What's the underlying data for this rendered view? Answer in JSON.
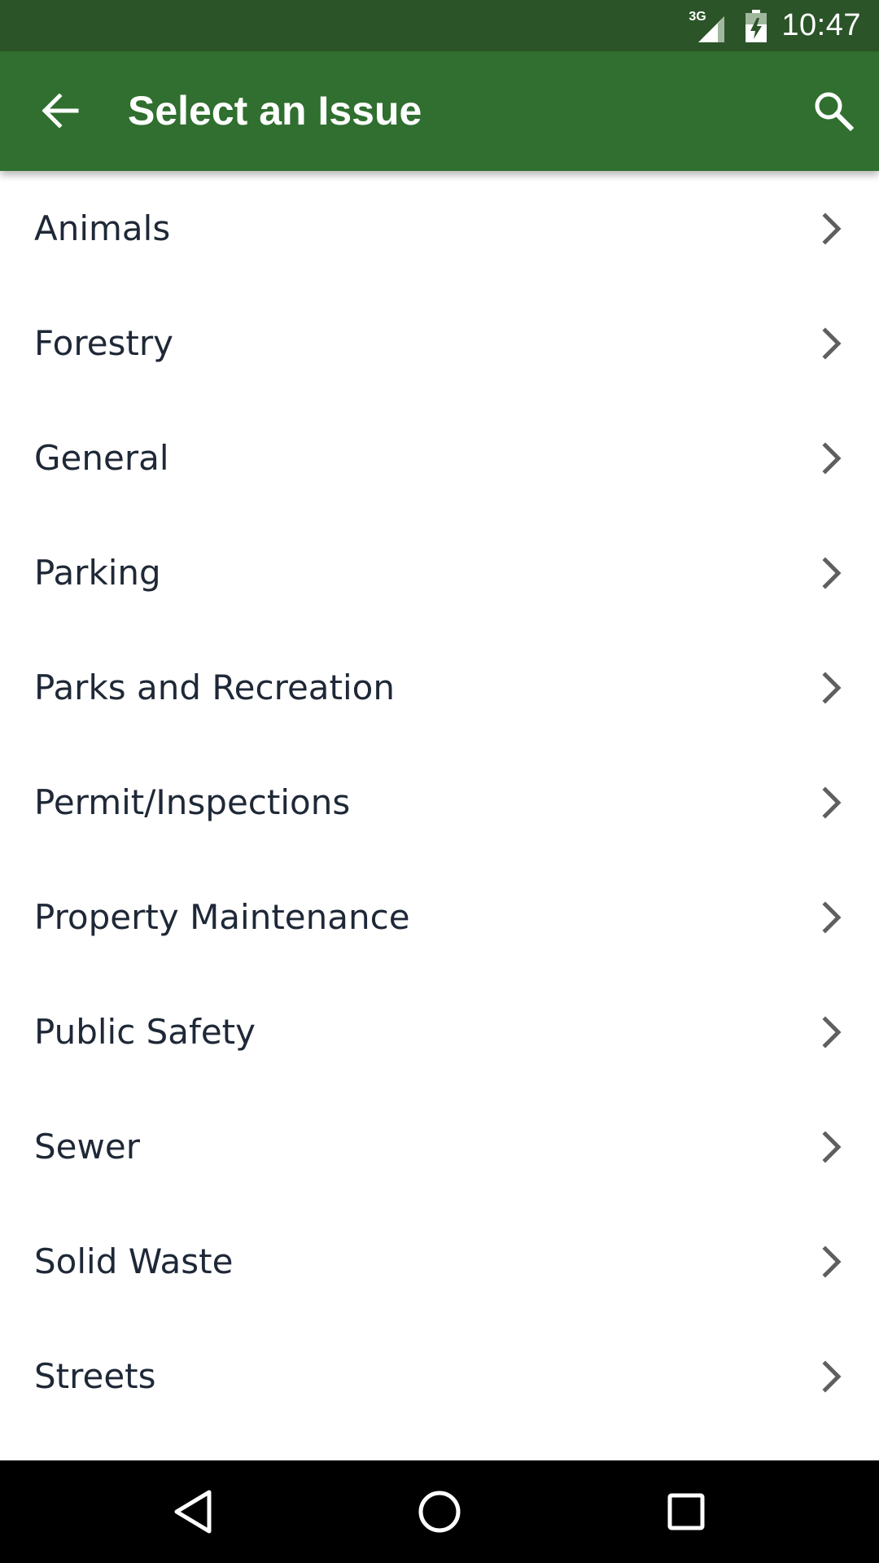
{
  "status_bar": {
    "network_label": "3G",
    "time": "10:47",
    "icons": [
      "signal-icon",
      "battery-charging-icon"
    ]
  },
  "app_bar": {
    "title": "Select an Issue",
    "back_icon": "arrow-left-icon",
    "search_icon": "search-icon",
    "color": "#306f2f",
    "status_color": "#2b5428"
  },
  "issues": [
    {
      "label": "Animals"
    },
    {
      "label": "Forestry"
    },
    {
      "label": "General"
    },
    {
      "label": "Parking"
    },
    {
      "label": "Parks and Recreation"
    },
    {
      "label": "Permit/Inspections"
    },
    {
      "label": "Property Maintenance"
    },
    {
      "label": "Public Safety"
    },
    {
      "label": "Sewer"
    },
    {
      "label": "Solid Waste"
    },
    {
      "label": "Streets"
    }
  ],
  "nav_bar": {
    "icons": [
      "back-triangle-icon",
      "home-circle-icon",
      "recents-square-icon"
    ]
  }
}
